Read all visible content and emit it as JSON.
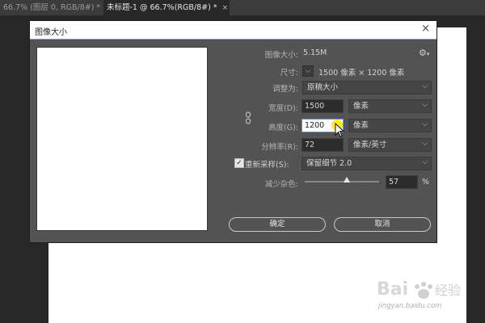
{
  "tabs": [
    {
      "label": "66.7% (图层 0, RGB/8#) *",
      "close": "×"
    },
    {
      "label": "未标题-1 @ 66.7%(RGB/8#) *",
      "close": "×"
    }
  ],
  "dialog": {
    "title": "图像大小",
    "close": "×",
    "image_size_label": "图像大小:",
    "image_size_value": "5.15M",
    "dimensions_label": "尺寸:",
    "dimensions_value": "1500 像素  ×  1200 像素",
    "fit_to_label": "调整为:",
    "fit_to_value": "原稿大小",
    "width_label": "宽度(D):",
    "width_value": "1500",
    "width_unit": "像素",
    "height_label": "高度(G):",
    "height_value": "1200",
    "height_unit": "像素",
    "resolution_label": "分辨率(R):",
    "resolution_value": "72",
    "resolution_unit": "像素/英寸",
    "resample_label": "重新采样(S):",
    "resample_value": "保留细节 2.0",
    "resample_checked": true,
    "noise_label": "减少杂色:",
    "noise_value": "57",
    "noise_percent": 57,
    "noise_unit": "%",
    "ok_label": "确定",
    "cancel_label": "取消"
  },
  "watermark": {
    "text": "Bai 经验",
    "url": "jingyan.baidu.com"
  },
  "colors": {
    "accent": "#6e90c8",
    "highlight": "#ffe600"
  }
}
